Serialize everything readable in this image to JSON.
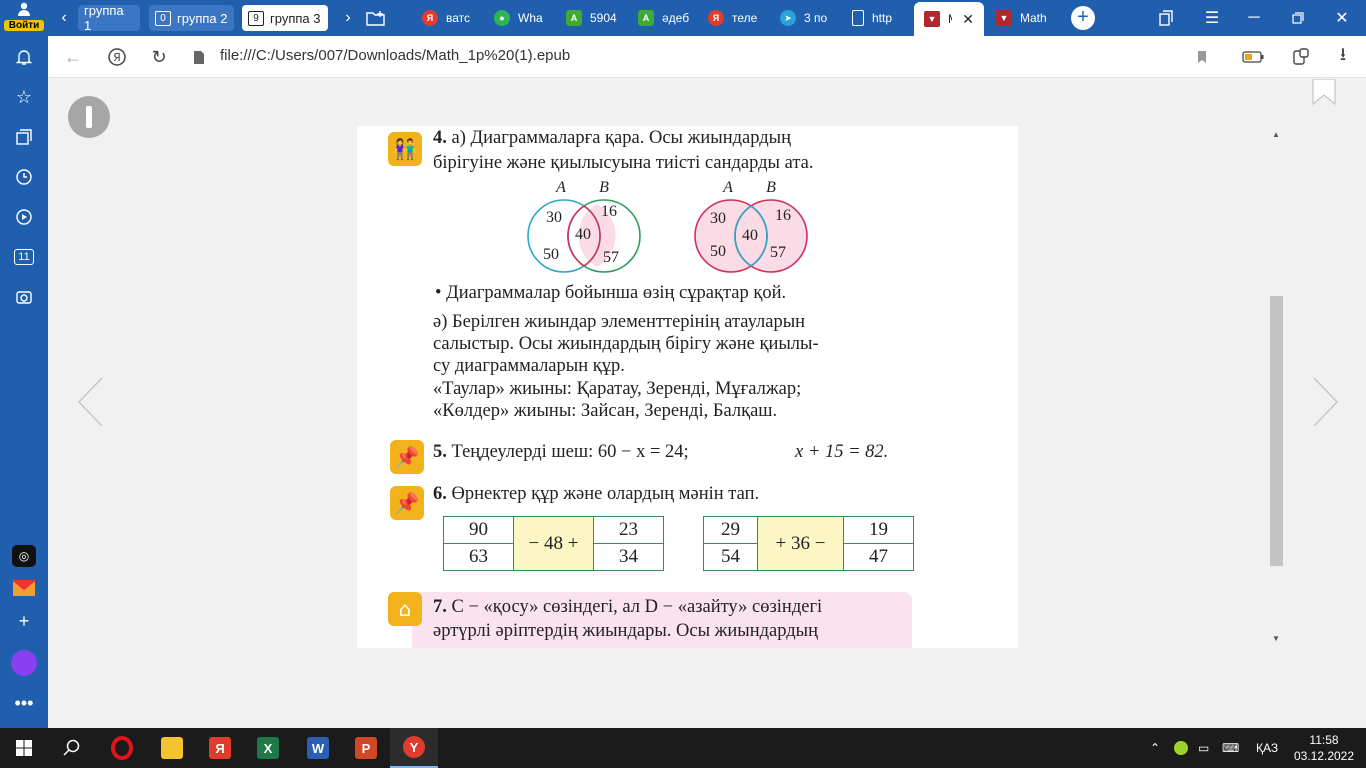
{
  "tabbar": {
    "groups": [
      {
        "count": "",
        "label": "группа 1"
      },
      {
        "count": "0",
        "label": "группа 2"
      },
      {
        "count": "9",
        "label": "группа 3"
      }
    ],
    "tabs": [
      {
        "favicon": "yandex-icon",
        "color": "#e03c2e",
        "label": "ватс"
      },
      {
        "favicon": "whatsapp-icon",
        "color": "#2fb553",
        "label": "Wha"
      },
      {
        "favicon": "a-green-icon",
        "color": "#3fab35",
        "label": "5904"
      },
      {
        "favicon": "a-green-icon",
        "color": "#3fab35",
        "label": "әдеб"
      },
      {
        "favicon": "yandex-icon",
        "color": "#e03c2e",
        "label": "теле"
      },
      {
        "favicon": "telegram-icon",
        "color": "#2aa1da",
        "label": "3 по"
      },
      {
        "favicon": "file-icon",
        "color": "#ffffff",
        "label": "http"
      },
      {
        "favicon": "epub-icon",
        "color": "#b3262e",
        "label": "M"
      },
      {
        "favicon": "epub-icon",
        "color": "#b3262e",
        "label": "Math"
      }
    ]
  },
  "addressbar": {
    "url": "file:///C:/Users/007/Downloads/Math_1p%20(1).epub"
  },
  "sidebar": {
    "login_label": "Войти",
    "counter": "11"
  },
  "book": {
    "task4": {
      "number": "4.",
      "line1": "а) Диаграммаларға қара. Осы жиындардың",
      "line2": "бірігуіне және қиылысуына тиісті сандарды ата."
    },
    "venn": [
      {
        "label_a": "A",
        "label_b": "B",
        "a_only_1": "30",
        "a_only_2": "50",
        "both": "40",
        "b_only_1": "16",
        "b_only_2": "57"
      },
      {
        "label_a": "A",
        "label_b": "B",
        "a_only_1": "30",
        "a_only_2": "50",
        "both": "40",
        "b_only_1": "16",
        "b_only_2": "57"
      }
    ],
    "bullet": "•  Диаграммалар бойынша өзің сұрақтар қой.",
    "task4b": [
      "ә) Берілген жиындар элементтерінің атауларын",
      "салыстыр. Осы жиындардың бірігу және қиылы-",
      "су диаграммаларын құр.",
      "«Таулар» жиыны: Қаратау, Зеренді, Мұғалжар;",
      "«Көлдер» жиыны: Зайсан, Зеренді, Балқаш."
    ],
    "task5": {
      "number": "5.",
      "text": "Теңдеулерді шеш: 60 − x = 24;",
      "text2": "x + 15 = 82."
    },
    "task6": {
      "number": "6.",
      "text": "Өрнектер құр және олардың мәнін тап."
    },
    "table1": {
      "left": [
        "90",
        "63"
      ],
      "middle": "− 48 +",
      "right": [
        "23",
        "34"
      ]
    },
    "table2": {
      "left": [
        "29",
        "54"
      ],
      "middle": "+ 36 −",
      "right": [
        "19",
        "47"
      ]
    },
    "task7": {
      "number": "7.",
      "line1": "C − «қосу» сөзіндегі, ал D − «азайту» сөзіндегі",
      "line2": "әртүрлі әріптердің жиындары. Осы жиындардың"
    }
  },
  "taskbar": {
    "language": "ҚАЗ",
    "time": "11:58",
    "date": "03.12.2022"
  }
}
